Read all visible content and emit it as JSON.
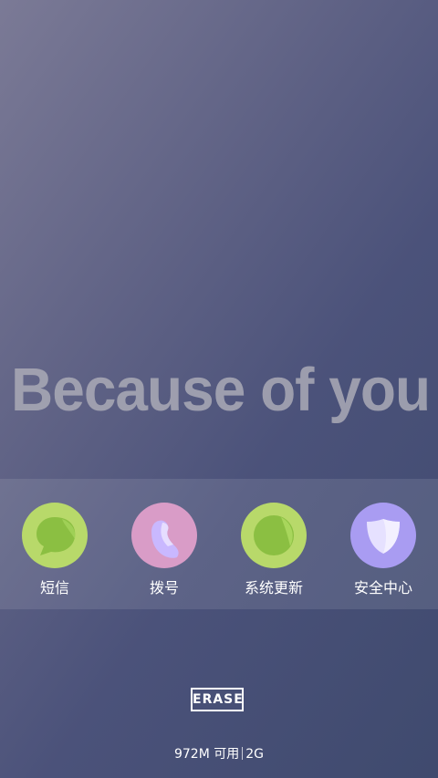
{
  "wallpaper": {
    "headline": "Because of you"
  },
  "dock": {
    "apps": [
      {
        "label": "短信",
        "icon": "message-icon",
        "color": "#b8d96a",
        "accent": "#8bbf42"
      },
      {
        "label": "拨号",
        "icon": "phone-icon",
        "color": "#d99cc7",
        "accent": "#c9b8ff"
      },
      {
        "label": "系统更新",
        "icon": "update-icon",
        "color": "#b8d96a",
        "accent": "#8bbf42"
      },
      {
        "label": "安全中心",
        "icon": "shield-icon",
        "color": "#a99cf2",
        "accent": "#e6e1ff"
      }
    ]
  },
  "erase_button": {
    "label": "ERASE"
  },
  "memory": {
    "available": "972M 可用",
    "network": "2G"
  }
}
